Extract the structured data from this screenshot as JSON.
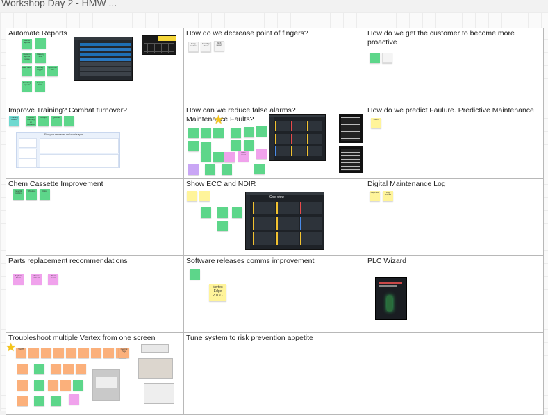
{
  "board": {
    "title": "Workshop Day 2 - HMW ..."
  },
  "cells": [
    {
      "key": "automate",
      "title": "Automate Reports",
      "notes": [
        "Teams reports",
        "",
        "Custom reports by site",
        "Data by time",
        "Raw data",
        "Weekly trigger",
        "Up to live pts",
        "Emailing reports",
        "Export data",
        ""
      ]
    },
    {
      "key": "fingers",
      "title": "How do we decrease point of fingers?",
      "notes": [
        "Daily review",
        "Monthly check",
        "Shift report"
      ]
    },
    {
      "key": "proactive",
      "title": "How do we get the customer to become more proactive",
      "notes": [
        "",
        ""
      ]
    },
    {
      "key": "training",
      "title": "Improve Training? Combat turnover?",
      "notes": [
        "Training videos",
        "Guided learning on screens",
        "Tooltips",
        "Quizzes",
        ""
      ],
      "card_heading": "Find your resources and mobile apps"
    },
    {
      "key": "alarms",
      "title": "How can we reduce false alarms? Maintenance Faults?",
      "notes": [
        "",
        "",
        "",
        "",
        "",
        "",
        "",
        "",
        "",
        "",
        "",
        "",
        "",
        "OPC client",
        "",
        "",
        "",
        "",
        ""
      ]
    },
    {
      "key": "predict",
      "title": "How do we predict Faulure. Predictive Maintenance",
      "notes": [
        "TGMS"
      ]
    },
    {
      "key": "cassette",
      "title": "Chem Cassette Improvement",
      "notes": [
        "Tape life tracking",
        "Wireless",
        "Clips"
      ]
    },
    {
      "key": "ecc",
      "title": "Show ECC and NDIR",
      "notes": [
        "",
        "",
        "",
        "",
        "",
        ""
      ],
      "screen_title": "Overview"
    },
    {
      "key": "maintlog",
      "title": "Digital Maintenance Log",
      "notes": [
        "Days left",
        "Log entries"
      ]
    },
    {
      "key": "parts",
      "title": "Parts replacement recommendations",
      "notes": [
        "Replace filters",
        "Spare parts list",
        "Wear items"
      ]
    },
    {
      "key": "software",
      "title": "Software releases comms improvement",
      "notes": [
        "",
        "Vertex Edge 2019 -"
      ]
    },
    {
      "key": "plc",
      "title": "PLC Wizard",
      "notes": []
    },
    {
      "key": "troubleshoot",
      "title": "Troubleshoot multiple Vertex from one screen",
      "notes": [
        "TGMS",
        "",
        "",
        "",
        "",
        "",
        "",
        "",
        "",
        "Central Page",
        "",
        "",
        "",
        "",
        "",
        "",
        "",
        "",
        "",
        "",
        "",
        "",
        "",
        ""
      ]
    },
    {
      "key": "tune",
      "title": "Tune system to risk prevention appetite",
      "notes": []
    },
    {
      "key": "empty",
      "title": "",
      "notes": []
    }
  ],
  "colors": {
    "sticky_green": "#5dd68a",
    "sticky_yellow": "#fff49a",
    "sticky_orange": "#fbb07b",
    "sticky_pink": "#f0a2ec",
    "star": "#f5c518"
  },
  "icons": [
    "star-icon"
  ]
}
